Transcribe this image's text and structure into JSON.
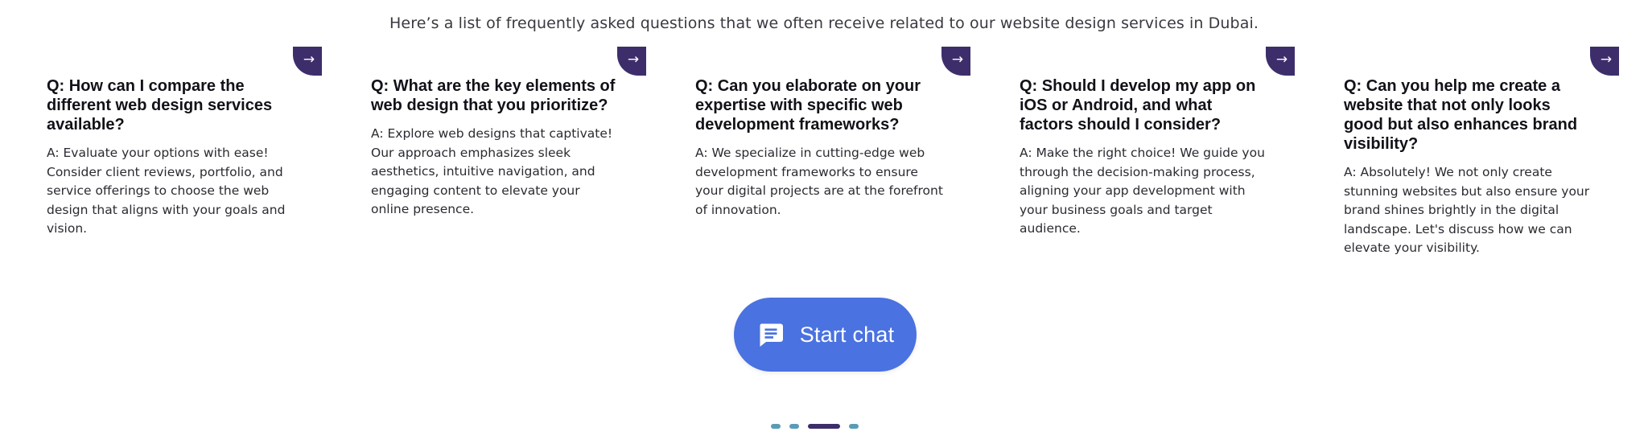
{
  "intro": {
    "text": "Here’s a list of frequently asked questions that we often receive related to our website design services in Dubai."
  },
  "faq": [
    {
      "arrow": "→",
      "question": "Q: How can I compare the different web design services available?",
      "answer": "A: Evaluate your options with ease! Consider client reviews, portfolio, and service offerings to choose the web design that aligns with your goals and vision."
    },
    {
      "arrow": "→",
      "question": "Q: What are the key elements of web design that you prioritize?",
      "answer": "A: Explore web designs that captivate! Our approach emphasizes sleek aesthetics, intuitive navigation, and engaging content to elevate your online presence."
    },
    {
      "arrow": "→",
      "question": "Q: Can you elaborate on your expertise with specific web development frameworks?",
      "answer": "A: We specialize in cutting-edge web development frameworks to ensure your digital projects are at the forefront of innovation."
    },
    {
      "arrow": "→",
      "question": "Q: Should I develop my app on iOS or Android, and what factors should I consider?",
      "answer": "A: Make the right choice! We guide you through the decision-making process, aligning your app development with your business goals and target audience."
    },
    {
      "arrow": "→",
      "question": "Q: Can you help me create a website that not only looks good but also enhances brand visibility?",
      "answer": "A: Absolutely! We not only create stunning websites but also ensure your brand shines brightly in the digital landscape. Let's discuss how we can elevate your visibility."
    }
  ],
  "chat": {
    "label": "Start chat",
    "icon": "chat-bubble-icon"
  },
  "carousel": {
    "count": 4,
    "active_index": 2
  },
  "colors": {
    "accent_dark": "#3d2e6b",
    "chat_blue": "#4a72e0",
    "dot_teal": "#5a9cb6"
  }
}
